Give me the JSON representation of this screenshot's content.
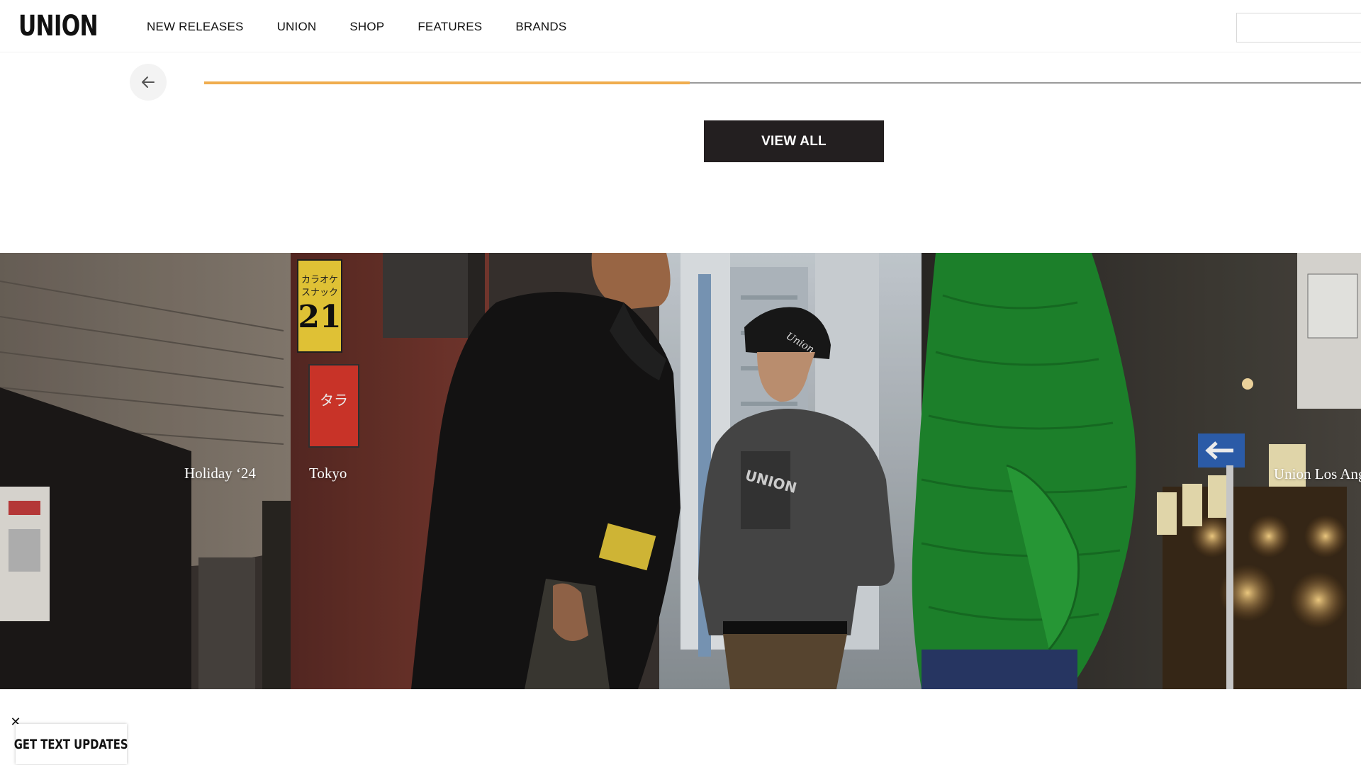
{
  "header": {
    "logo": "UNION",
    "nav": [
      "NEW RELEASES",
      "UNION",
      "SHOP",
      "FEATURES",
      "BRANDS"
    ],
    "search_placeholder": ""
  },
  "carousel": {
    "progress_percent": 42,
    "accent_color": "#f0ad4e",
    "prev_icon": "arrow-left-icon"
  },
  "buttons": {
    "view_all": "VIEW ALL"
  },
  "hero": {
    "labels": [
      "Holiday ‘24",
      "Tokyo",
      "Union Los Angeles"
    ],
    "sign_text": {
      "karaoke": "カラオケ",
      "snack": "スナック",
      "number": "21",
      "tara": "タラ"
    },
    "beanie_text": "Union",
    "shirt_text": "UNION"
  },
  "popup": {
    "text_updates": "GET TEXT UPDATES",
    "close": "✕"
  }
}
